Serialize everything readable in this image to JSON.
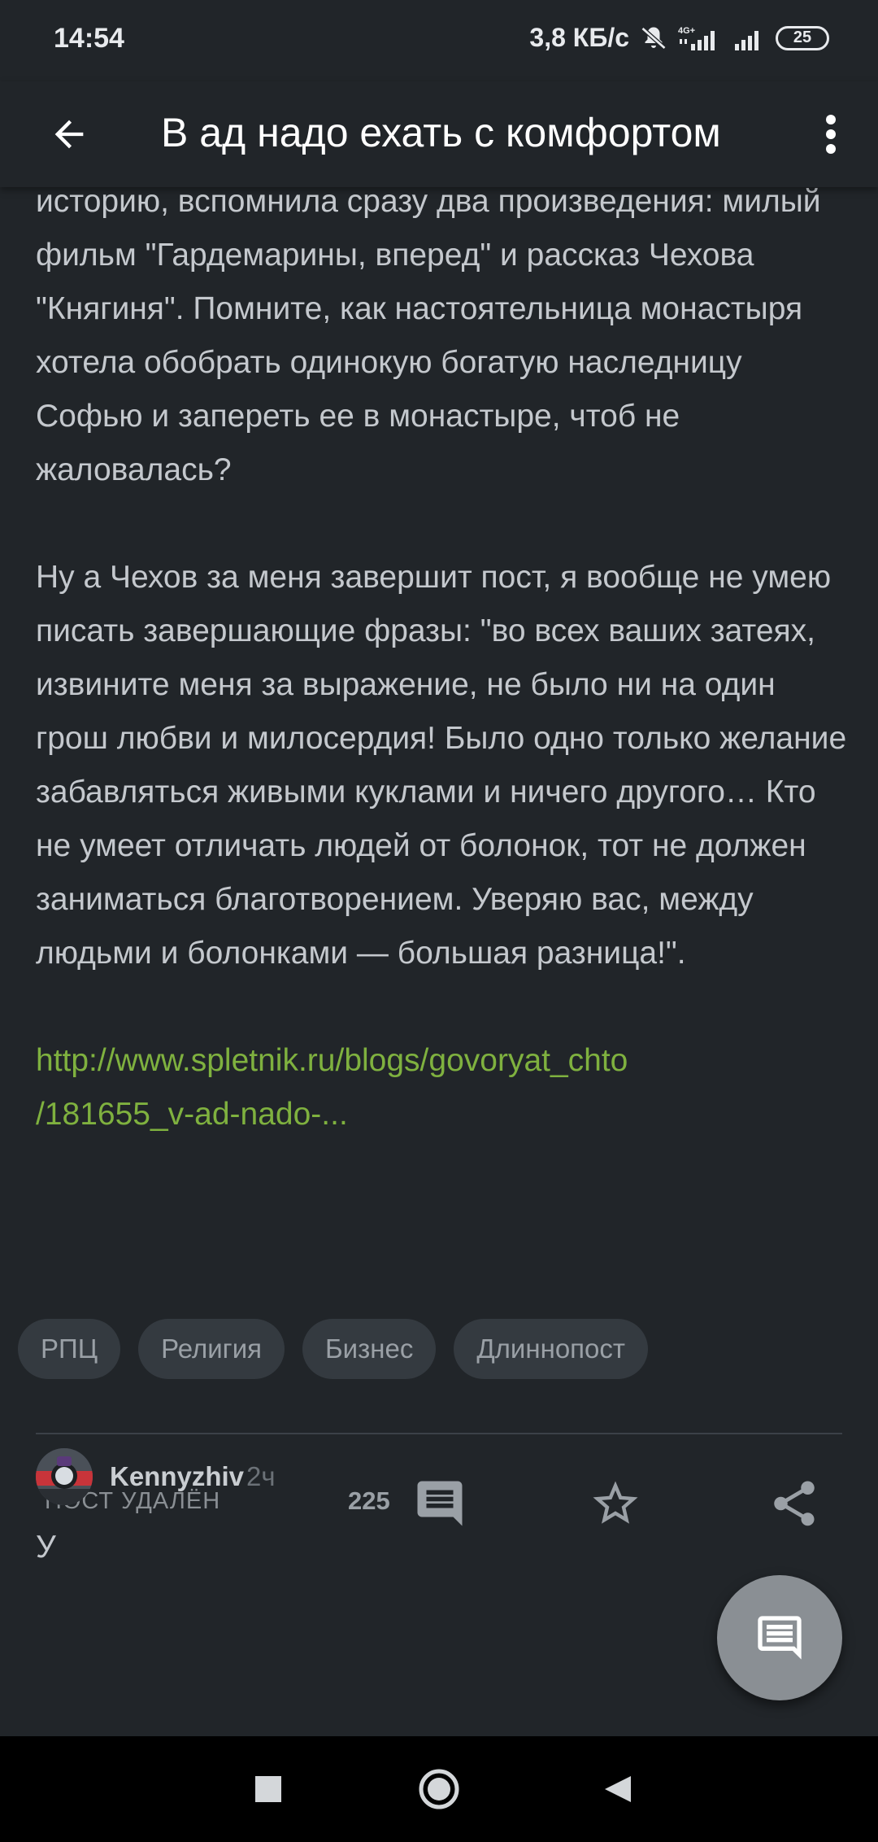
{
  "status_bar": {
    "time": "14:54",
    "network_speed": "3,8 КБ/с",
    "network_type": "4G+",
    "battery": "25"
  },
  "app_bar": {
    "title": "В ад надо ехать с комфортом"
  },
  "article": {
    "paragraphs": [
      "историю, вспомнила сразу два произведения: милый фильм \"Гардемарины, вперед\" и рассказ Чехова \"Княгиня\". Помните, как настоятельница монастыря хотела обобрать одинокую богатую наследницу Софью и запереть ее в монастыре, чтоб не жаловалась?",
      "Ну а Чехов за меня завершит пост, я вообще не умею писать завершающие фразы: \"во всех ваших затеях, извините меня за выражение, не было ни на один грош любви и милосердия! Было одно только желание забавляться живыми куклами и ничего другого… Кто не умеет отличать людей от болонок, тот не должен заниматься благотворением. Уверяю вас, между людьми и болонками — большая разница!\"."
    ],
    "link_line1": "http://www.spletnik.ru/blogs/govoryat_chto",
    "link_line2": "/181655_v-ad-nado-..."
  },
  "tags": [
    "РПЦ",
    "Религия",
    "Бизнес",
    "Длиннопост"
  ],
  "footer": {
    "deleted_label": "ПОСТ УДАЛЁН",
    "comments_count": "225"
  },
  "comment": {
    "username": "Kennyzhiv",
    "time_ago": "2ч",
    "text_start": "У"
  },
  "colors": {
    "background": "#212529",
    "link": "#7fb13f",
    "tag_bg": "#343a40",
    "fab": "#8a8f94"
  }
}
